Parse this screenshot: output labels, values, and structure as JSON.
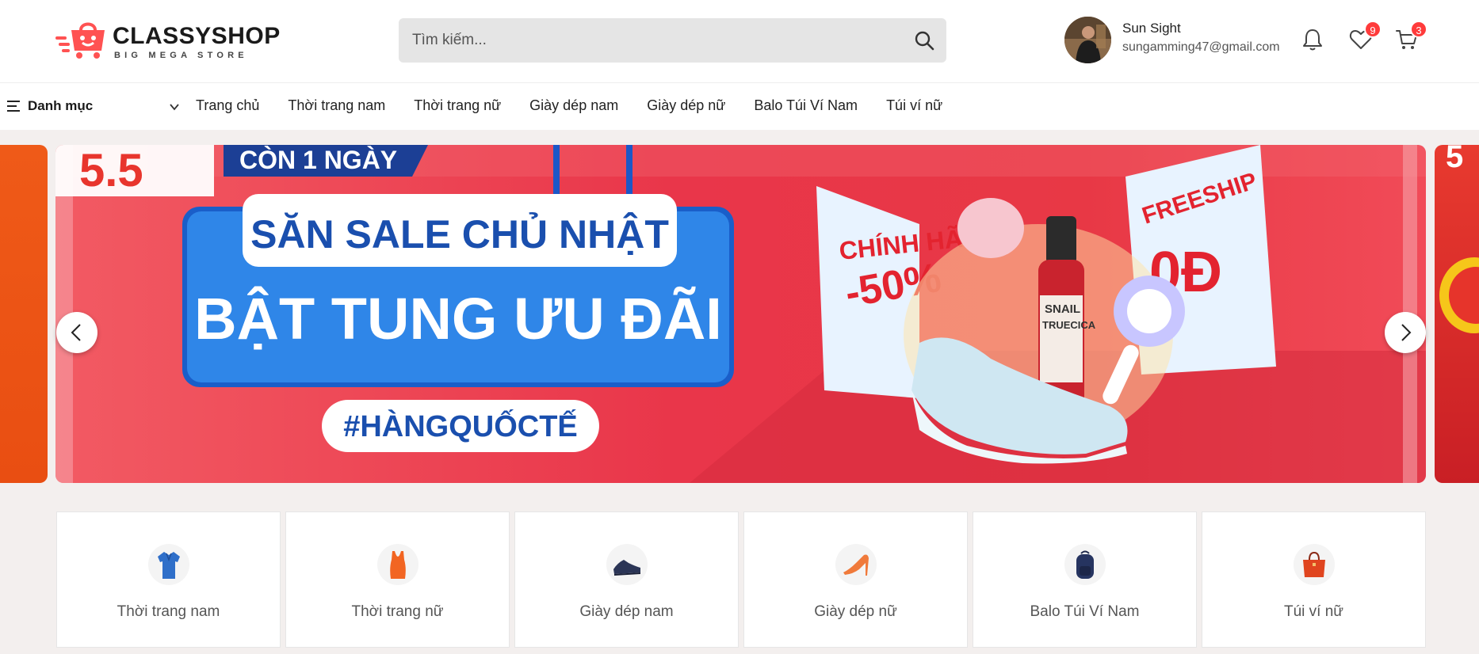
{
  "brand": {
    "name": "CLASSYSHOP",
    "tagline": "BIG MEGA STORE",
    "color": "#ff5252"
  },
  "search": {
    "placeholder": "Tìm kiếm...",
    "value": ""
  },
  "user": {
    "name": "Sun Sight",
    "email": "sungamming47@gmail.com"
  },
  "header_icons": {
    "notifications": {
      "icon": "bell-icon"
    },
    "wishlist": {
      "icon": "heart-icon",
      "count": "9"
    },
    "cart": {
      "icon": "cart-icon",
      "count": "3"
    }
  },
  "nav": {
    "category_label": "Danh mục",
    "links": [
      "Trang chủ",
      "Thời trang nam",
      "Thời trang nữ",
      "Giày dép nam",
      "Giày dép nữ",
      "Balo Túi Ví Nam",
      "Túi ví nữ"
    ]
  },
  "banner": {
    "event": "5.5",
    "countdown": "CÒN 1 NGÀY",
    "line1": "SĂN SALE CHỦ NHẬT",
    "line2": "BẬT TUNG ƯU ĐÃI",
    "hashtag": "#HÀNGQUỐCTẾ",
    "sign_left_1": "CHÍNH HÃNG",
    "sign_left_2": "-50%",
    "sign_right_1": "FREESHIP",
    "sign_right_2": "0Đ",
    "product_label_1": "SNAIL",
    "product_label_2": "TRUECICA"
  },
  "categories": [
    {
      "name": "Thời trang nam",
      "icon": "polo-shirt-icon"
    },
    {
      "name": "Thời trang nữ",
      "icon": "tank-top-icon"
    },
    {
      "name": "Giày dép nam",
      "icon": "mens-shoe-icon"
    },
    {
      "name": "Giày dép nữ",
      "icon": "high-heel-icon"
    },
    {
      "name": "Balo Túi Ví Nam",
      "icon": "backpack-icon"
    },
    {
      "name": "Túi ví nữ",
      "icon": "handbag-icon"
    }
  ]
}
